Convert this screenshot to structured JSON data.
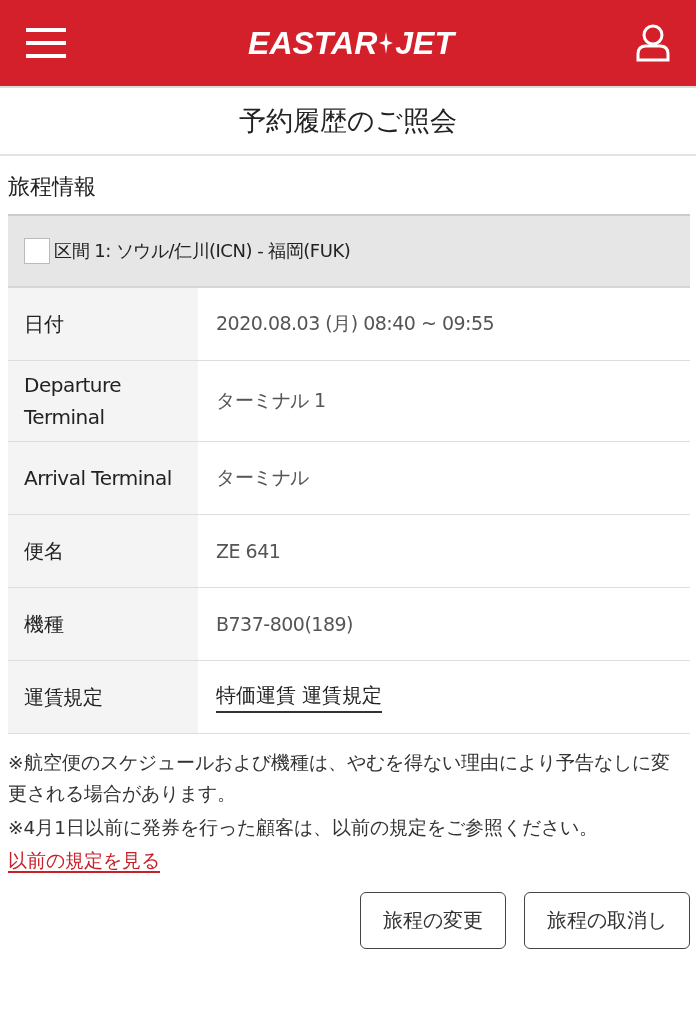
{
  "header": {
    "logo_left": "EASTAR",
    "logo_right": "JET"
  },
  "page_title": "予約履歴のご照会",
  "section_title": "旅程情報",
  "segment": {
    "checked": false,
    "label": "区間 1: ソウル/仁川(ICN) - 福岡(FUK)"
  },
  "rows": [
    {
      "label": "日付",
      "value": "2020.08.03 (月) 08:40 ~ 09:55",
      "kind": "text"
    },
    {
      "label": "Departure Terminal",
      "value": "ターミナル 1",
      "kind": "text"
    },
    {
      "label": "Arrival Terminal",
      "value": "ターミナル",
      "kind": "text"
    },
    {
      "label": "便名",
      "value": "ZE 641",
      "kind": "text"
    },
    {
      "label": "機種",
      "value": "B737-800(189)",
      "kind": "text"
    },
    {
      "label": "運賃規定",
      "value": "特価運賃 運賃規定",
      "kind": "link"
    }
  ],
  "notes": [
    "※航空便のスケジュールおよび機種は、やむを得ない理由により予告なしに変更される場合があります。",
    "※4月1日以前に発券を行った顧客は、以前の規定をご参照ください。"
  ],
  "rules_link": "以前の規定を見る",
  "buttons": [
    "旅程の変更",
    "旅程の取消し"
  ]
}
